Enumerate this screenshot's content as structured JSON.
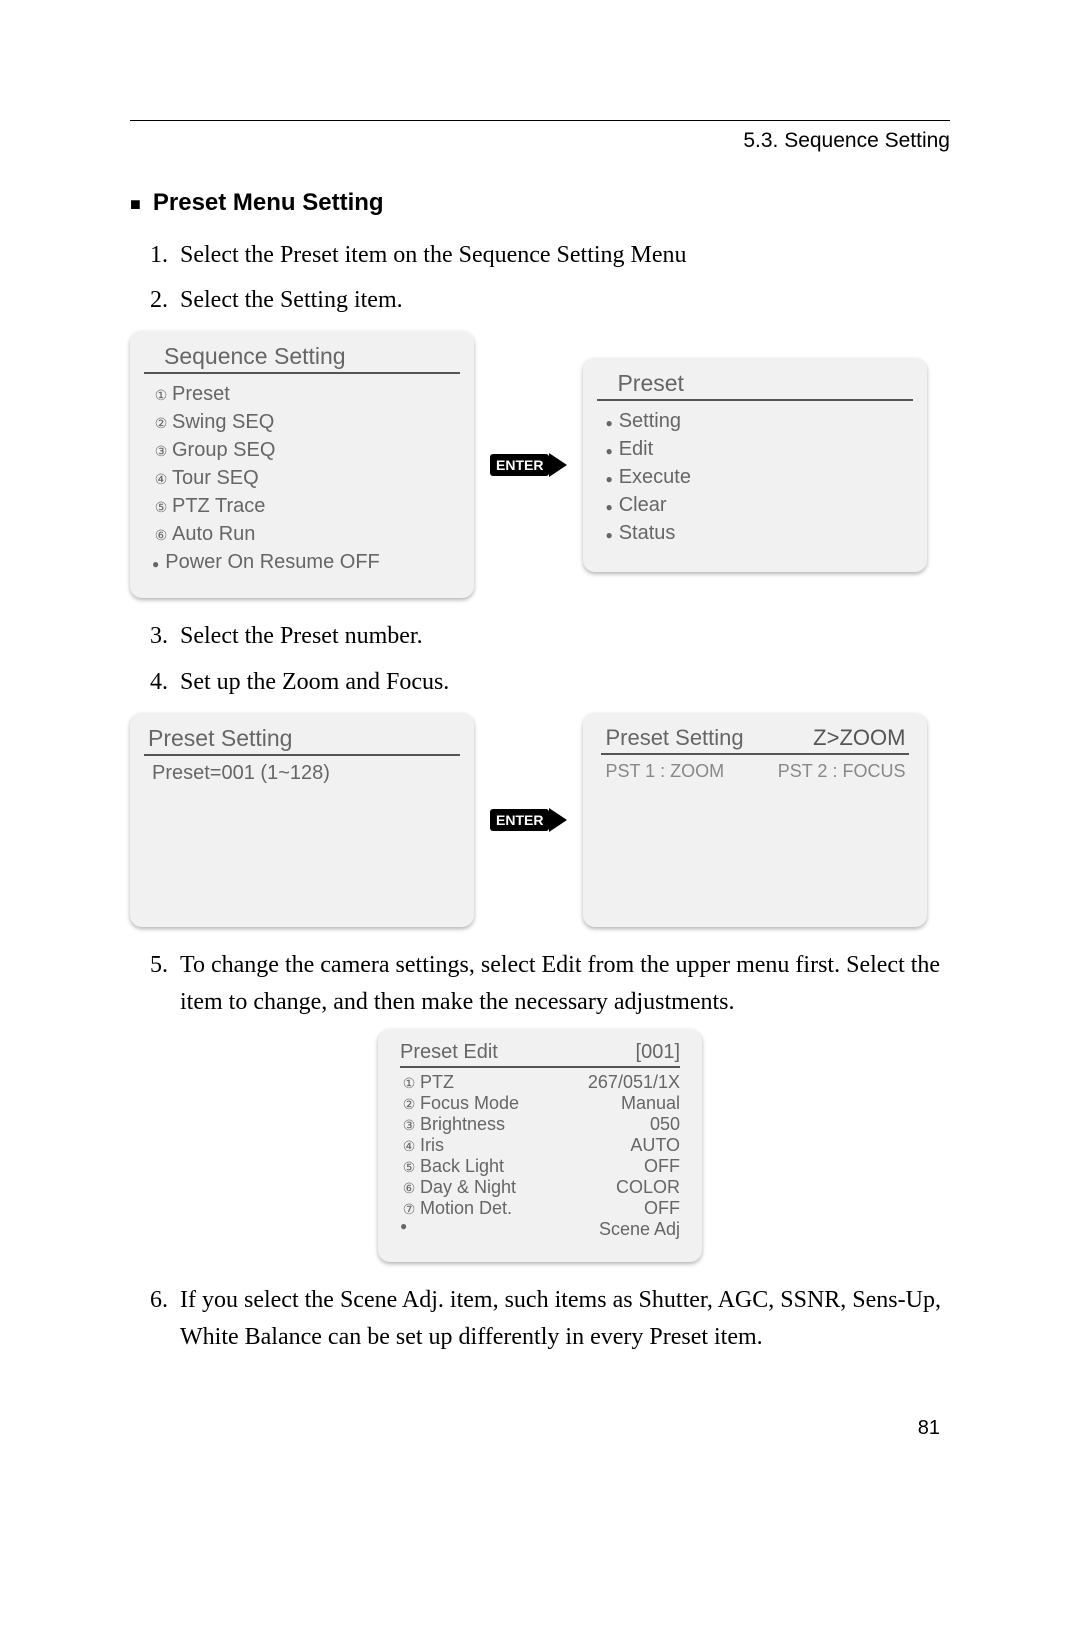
{
  "header": {
    "breadcrumb": "5.3. Sequence Setting"
  },
  "section_title": "Preset Menu Setting",
  "steps": {
    "s1": "Select the Preset item on the Sequence Setting Menu",
    "s2": "Select the Setting item.",
    "s3": "Select the Preset number.",
    "s4": "Set up the Zoom and Focus.",
    "s5": "To change the camera settings, select Edit from the upper menu first. Select the item to change, and then make the necessary adjustments.",
    "s6": "If you select the Scene Adj. item, such items as Shutter, AGC, SSNR, Sens-Up, White Balance can be set up differently in every Preset item."
  },
  "enter_label": "ENTER",
  "panel_sequence": {
    "title": "Sequence Setting",
    "items": [
      {
        "n": "①",
        "label": "Preset"
      },
      {
        "n": "②",
        "label": "Swing SEQ"
      },
      {
        "n": "③",
        "label": "Group SEQ"
      },
      {
        "n": "④",
        "label": "Tour SEQ"
      },
      {
        "n": "⑤",
        "label": "PTZ Trace"
      },
      {
        "n": "⑥",
        "label": "Auto Run"
      }
    ],
    "bullet_item": "Power On Resume OFF"
  },
  "panel_preset": {
    "title": "Preset",
    "items": [
      "Setting",
      "Edit",
      "Execute",
      "Clear",
      "Status"
    ]
  },
  "panel_preset_setting_left": {
    "title": "Preset Setting",
    "body": "Preset=001 (1~128)"
  },
  "panel_preset_setting_right": {
    "title_left": "Preset Setting",
    "title_right": "Z>ZOOM",
    "row_left": "PST 1 : ZOOM",
    "row_right": "PST 2 : FOCUS"
  },
  "panel_edit": {
    "title_left": "Preset Edit",
    "title_right": "[001]",
    "rows": [
      {
        "n": "①",
        "l": "PTZ",
        "v": "267/051/1X"
      },
      {
        "n": "②",
        "l": "Focus Mode",
        "v": "Manual"
      },
      {
        "n": "③",
        "l": "Brightness",
        "v": "050"
      },
      {
        "n": "④",
        "l": "Iris",
        "v": "AUTO"
      },
      {
        "n": "⑤",
        "l": "Back Light",
        "v": "OFF"
      },
      {
        "n": "⑥",
        "l": "Day & Night",
        "v": "COLOR"
      },
      {
        "n": "⑦",
        "l": "Motion Det.",
        "v": "OFF"
      }
    ],
    "bullet_item": "Scene Adj"
  },
  "page_number": "81"
}
